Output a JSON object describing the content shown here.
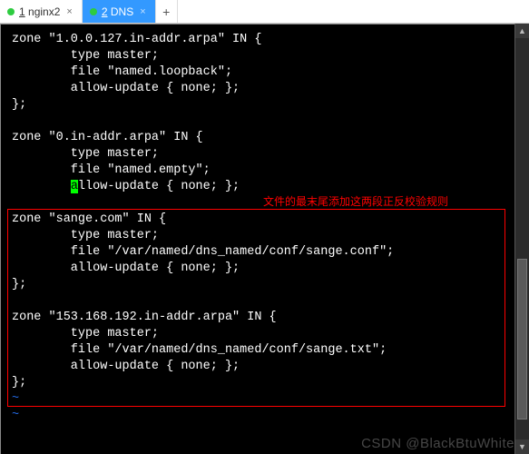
{
  "tabs": {
    "items": [
      {
        "num_key": "1",
        "label": "nginx2",
        "active": false
      },
      {
        "num_key": "2",
        "label": "DNS",
        "active": true
      }
    ],
    "add_label": "+"
  },
  "term": {
    "l01": "zone \"1.0.0.127.in-addr.arpa\" IN {",
    "l02": "        type master;",
    "l03": "        file \"named.loopback\";",
    "l04": "        allow-update { none; };",
    "l05": "};",
    "l06": "",
    "l07": "zone \"0.in-addr.arpa\" IN {",
    "l08": "        type master;",
    "l09": "        file \"named.empty\";",
    "l10_pre": "        ",
    "l10_cur": "a",
    "l10_post": "llow-update { none; };",
    "l11": "",
    "l12": "zone \"sange.com\" IN {",
    "l13": "        type master;",
    "l14": "        file \"/var/named/dns_named/conf/sange.conf\";",
    "l15": "        allow-update { none; };",
    "l16": "};",
    "l17": "",
    "l18": "zone \"153.168.192.in-addr.arpa\" IN {",
    "l19": "        type master;",
    "l20": "        file \"/var/named/dns_named/conf/sange.txt\";",
    "l21": "        allow-update { none; };",
    "l22": "};",
    "tilde": "~"
  },
  "annotation": {
    "text": "文件的最末尾添加这两段正反校验规则"
  },
  "watermark": {
    "text": "CSDN @BlackBtuWhite"
  },
  "scroll": {
    "up": "▲",
    "down": "▼"
  }
}
